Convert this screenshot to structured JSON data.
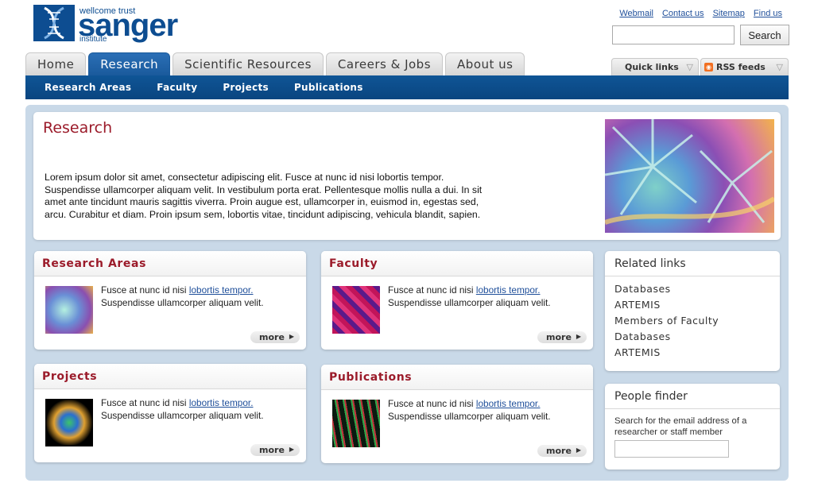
{
  "logo": {
    "line1": "wellcome trust",
    "line2": "sanger",
    "line3": "institute"
  },
  "utility_links": [
    "Webmail",
    "Contact us",
    "Sitemap",
    "Find us"
  ],
  "search": {
    "button_label": "Search",
    "placeholder": ""
  },
  "tabs": [
    {
      "label": "Home",
      "active": false
    },
    {
      "label": "Research",
      "active": true
    },
    {
      "label": "Scientific Resources",
      "active": false
    },
    {
      "label": "Careers & Jobs",
      "active": false
    },
    {
      "label": "About us",
      "active": false
    }
  ],
  "quick_links": "Quick links",
  "rss_feeds": "RSS feeds",
  "subnav": [
    "Research Areas",
    "Faculty",
    "Projects",
    "Publications"
  ],
  "hero": {
    "title": "Research",
    "text": "Lorem ipsum dolor sit amet, consectetur adipiscing elit. Fusce at nunc id nisi lobortis tempor. Suspendisse ullamcorper aliquam velit. In vestibulum porta erat. Pellentesque mollis nulla a dui. In sit amet ante tincidunt mauris sagittis viverra. Proin augue est, ullamcorper in, euismod in, egestas sed, arcu. Curabitur et diam. Proin ipsum sem, lobortis vitae, tincidunt adipiscing, vehicula blandit, sapien."
  },
  "cards": [
    {
      "title": "Research Areas",
      "text_before": "Fusce at nunc id nisi ",
      "link": "lobortis tempor.",
      "text_after": "Suspendisse ullamcorper aliquam velit.",
      "more": "more"
    },
    {
      "title": "Faculty",
      "text_before": "Fusce at nunc id nisi ",
      "link": "lobortis tempor.",
      "text_after": "Suspendisse ullamcorper aliquam velit.",
      "more": "more"
    },
    {
      "title": "Projects",
      "text_before": "Fusce at nunc id nisi ",
      "link": "lobortis tempor.",
      "text_after": "Suspendisse ullamcorper aliquam velit.",
      "more": "more"
    },
    {
      "title": "Publications",
      "text_before": "Fusce at nunc id nisi ",
      "link": "lobortis tempor.",
      "text_after": "Suspendisse ullamcorper aliquam velit.",
      "more": "more"
    }
  ],
  "related_links": {
    "title": "Related links",
    "items": [
      "Databases",
      "ARTEMIS",
      "Members of Faculty",
      "Databases",
      "ARTEMIS"
    ]
  },
  "people_finder": {
    "title": "People finder",
    "text": "Search for the email address of a researcher or staff member"
  },
  "colors": {
    "brand_blue": "#0d4d91",
    "accent_red": "#9b1b2a",
    "link_blue": "#1f4f9a"
  }
}
